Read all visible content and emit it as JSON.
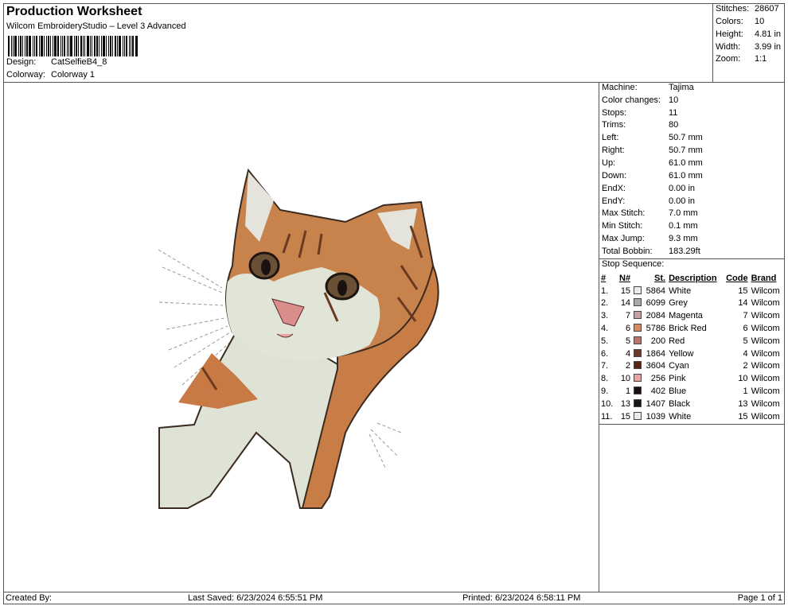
{
  "header": {
    "title": "Production Worksheet",
    "subtitle": "Wilcom EmbroideryStudio – Level 3 Advanced",
    "design_label": "Design:",
    "design_value": "CatSelfieB4_8",
    "colorway_label": "Colorway:",
    "colorway_value": "Colorway 1"
  },
  "stats": [
    {
      "label": "Stitches:",
      "value": "28607"
    },
    {
      "label": "Colors:",
      "value": "10"
    },
    {
      "label": "Height:",
      "value": "4.81 in"
    },
    {
      "label": "Width:",
      "value": "3.99 in"
    },
    {
      "label": "Zoom:",
      "value": "1:1"
    }
  ],
  "machine": [
    {
      "label": "Machine:",
      "value": "Tajima"
    },
    {
      "label": "Color changes:",
      "value": "10"
    },
    {
      "label": "Stops:",
      "value": "11"
    },
    {
      "label": "Trims:",
      "value": "80"
    },
    {
      "label": "Left:",
      "value": "50.7 mm"
    },
    {
      "label": "Right:",
      "value": "50.7 mm"
    },
    {
      "label": "Up:",
      "value": "61.0 mm"
    },
    {
      "label": "Down:",
      "value": "61.0 mm"
    },
    {
      "label": "EndX:",
      "value": "0.00 in"
    },
    {
      "label": "EndY:",
      "value": "0.00 in"
    },
    {
      "label": "Max Stitch:",
      "value": "7.0 mm"
    },
    {
      "label": "Min Stitch:",
      "value": "0.1 mm"
    },
    {
      "label": "Max Jump:",
      "value": "9.3 mm"
    },
    {
      "label": "Total Bobbin:",
      "value": "183.29ft"
    }
  ],
  "sequence": {
    "title": "Stop Sequence:",
    "headers": [
      "#",
      "N#",
      "St.",
      "Description",
      "Code",
      "Brand"
    ],
    "rows": [
      {
        "no": "1.",
        "n": "15",
        "color": "#ececec",
        "st": "5864",
        "desc": "White",
        "code": "15",
        "brand": "Wilcom"
      },
      {
        "no": "2.",
        "n": "14",
        "color": "#a8a8a8",
        "st": "6099",
        "desc": "Grey",
        "code": "14",
        "brand": "Wilcom"
      },
      {
        "no": "3.",
        "n": "7",
        "color": "#c7a0a8",
        "st": "2084",
        "desc": "Magenta",
        "code": "7",
        "brand": "Wilcom"
      },
      {
        "no": "4.",
        "n": "6",
        "color": "#d98a62",
        "st": "5786",
        "desc": "Brick Red",
        "code": "6",
        "brand": "Wilcom"
      },
      {
        "no": "5.",
        "n": "5",
        "color": "#b9756a",
        "st": "200",
        "desc": "Red",
        "code": "5",
        "brand": "Wilcom"
      },
      {
        "no": "6.",
        "n": "4",
        "color": "#6b3a2c",
        "st": "1864",
        "desc": "Yellow",
        "code": "4",
        "brand": "Wilcom"
      },
      {
        "no": "7.",
        "n": "2",
        "color": "#5a2410",
        "st": "3604",
        "desc": "Cyan",
        "code": "2",
        "brand": "Wilcom"
      },
      {
        "no": "8.",
        "n": "10",
        "color": "#e8a4a4",
        "st": "256",
        "desc": "Pink",
        "code": "10",
        "brand": "Wilcom"
      },
      {
        "no": "9.",
        "n": "1",
        "color": "#1a1010",
        "st": "402",
        "desc": "Blue",
        "code": "1",
        "brand": "Wilcom"
      },
      {
        "no": "10.",
        "n": "13",
        "color": "#161616",
        "st": "1407",
        "desc": "Black",
        "code": "13",
        "brand": "Wilcom"
      },
      {
        "no": "11.",
        "n": "15",
        "color": "#ececec",
        "st": "1039",
        "desc": "White",
        "code": "15",
        "brand": "Wilcom"
      }
    ]
  },
  "footer": {
    "created_by": "Created By:",
    "last_saved": "Last Saved: 6/23/2024 6:55:51 PM",
    "printed": "Printed: 6/23/2024 6:58:11 PM",
    "page": "Page 1 of 1"
  }
}
